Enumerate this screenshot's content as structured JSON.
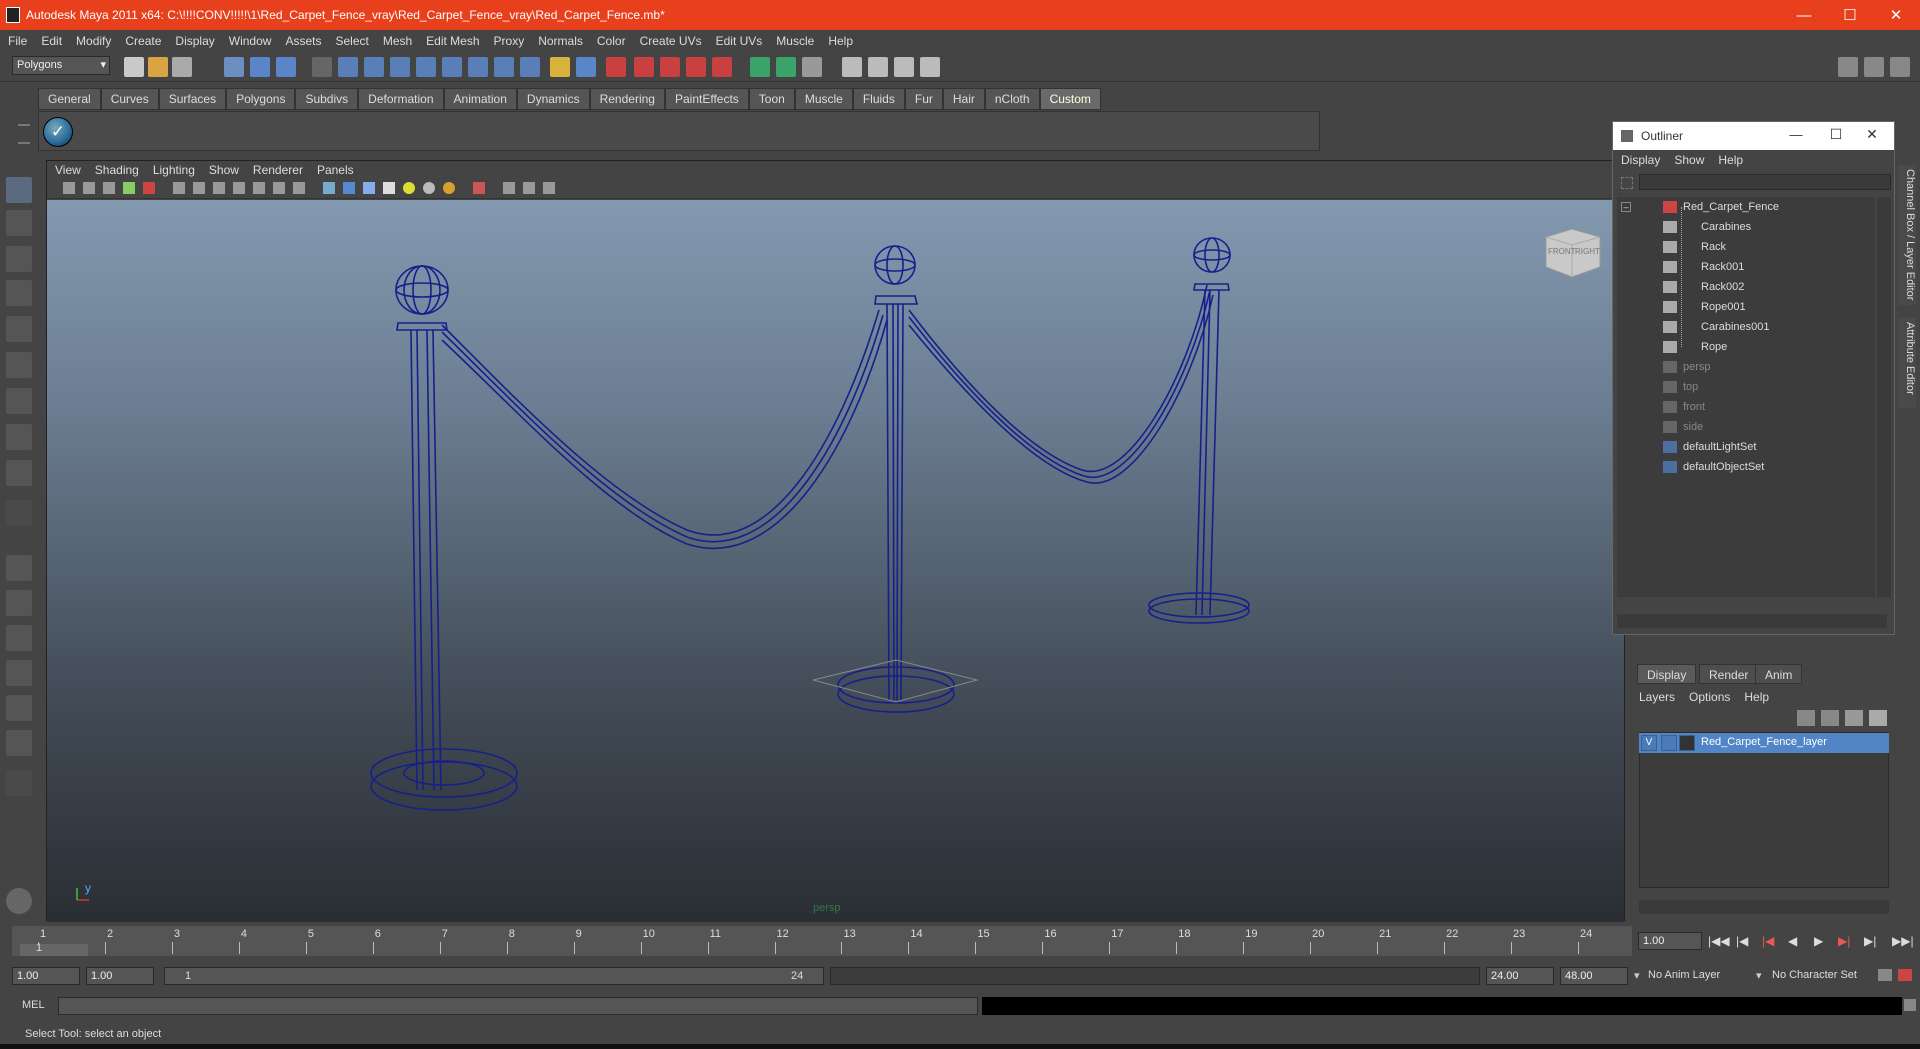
{
  "window": {
    "title": "Autodesk Maya 2011 x64: C:\\!!!!CONV!!!!!\\1\\Red_Carpet_Fence_vray\\Red_Carpet_Fence_vray\\Red_Carpet_Fence.mb*",
    "minimize_icon": "minimize-icon",
    "maximize_icon": "maximize-icon",
    "close_icon": "close-icon"
  },
  "menubar": [
    "File",
    "Edit",
    "Modify",
    "Create",
    "Display",
    "Window",
    "Assets",
    "Select",
    "Mesh",
    "Edit Mesh",
    "Proxy",
    "Normals",
    "Color",
    "Create UVs",
    "Edit UVs",
    "Muscle",
    "Help"
  ],
  "statusline": {
    "mode": "Polygons"
  },
  "shelf": {
    "tabs": [
      "General",
      "Curves",
      "Surfaces",
      "Polygons",
      "Subdivs",
      "Deformation",
      "Animation",
      "Dynamics",
      "Rendering",
      "PaintEffects",
      "Toon",
      "Muscle",
      "Fluids",
      "Fur",
      "Hair",
      "nCloth",
      "Custom"
    ],
    "active": "Custom"
  },
  "viewport": {
    "menu": [
      "View",
      "Shading",
      "Lighting",
      "Show",
      "Renderer",
      "Panels"
    ],
    "camera_label": "persp",
    "viewcube": {
      "front": "FRONT",
      "right": "RIGHT"
    },
    "axis": {
      "y": "y"
    }
  },
  "outliner": {
    "title": "Outliner",
    "menu": [
      "Display",
      "Show",
      "Help"
    ],
    "items": [
      {
        "name": "Red_Carpet_Fence",
        "indent": 0,
        "dim": false
      },
      {
        "name": "Carabines",
        "indent": 1,
        "dim": false
      },
      {
        "name": "Rack",
        "indent": 1,
        "dim": false
      },
      {
        "name": "Rack001",
        "indent": 1,
        "dim": false
      },
      {
        "name": "Rack002",
        "indent": 1,
        "dim": false
      },
      {
        "name": "Rope001",
        "indent": 1,
        "dim": false
      },
      {
        "name": "Carabines001",
        "indent": 1,
        "dim": false
      },
      {
        "name": "Rope",
        "indent": 1,
        "dim": false
      },
      {
        "name": "persp",
        "indent": 0,
        "dim": true
      },
      {
        "name": "top",
        "indent": 0,
        "dim": true
      },
      {
        "name": "front",
        "indent": 0,
        "dim": true
      },
      {
        "name": "side",
        "indent": 0,
        "dim": true
      },
      {
        "name": "defaultLightSet",
        "indent": 0,
        "dim": false
      },
      {
        "name": "defaultObjectSet",
        "indent": 0,
        "dim": false
      }
    ]
  },
  "side_tabs": {
    "channel_box": "Channel Box / Layer Editor",
    "attribute_editor": "Attribute Editor"
  },
  "layer_editor": {
    "tabs": [
      "Display",
      "Render",
      "Anim"
    ],
    "active_tab": "Display",
    "menu": [
      "Layers",
      "Options",
      "Help"
    ],
    "layers": [
      {
        "visible": "V",
        "name": "Red_Carpet_Fence_layer"
      }
    ]
  },
  "timeline": {
    "ticks": [
      "1",
      "2",
      "3",
      "4",
      "5",
      "6",
      "7",
      "8",
      "9",
      "10",
      "11",
      "12",
      "13",
      "14",
      "15",
      "16",
      "17",
      "18",
      "19",
      "20",
      "21",
      "22",
      "23",
      "24"
    ],
    "current_frame_marker": "1",
    "current_time": "1.00"
  },
  "range": {
    "start": "1.00",
    "playback_start": "1.00",
    "slider_start": "1",
    "slider_end": "24",
    "playback_end": "24.00",
    "end": "48.00",
    "anim_layer": "No Anim Layer",
    "character_set": "No Character Set"
  },
  "mel": {
    "label": "MEL"
  },
  "helpline": "Select Tool: select an object"
}
